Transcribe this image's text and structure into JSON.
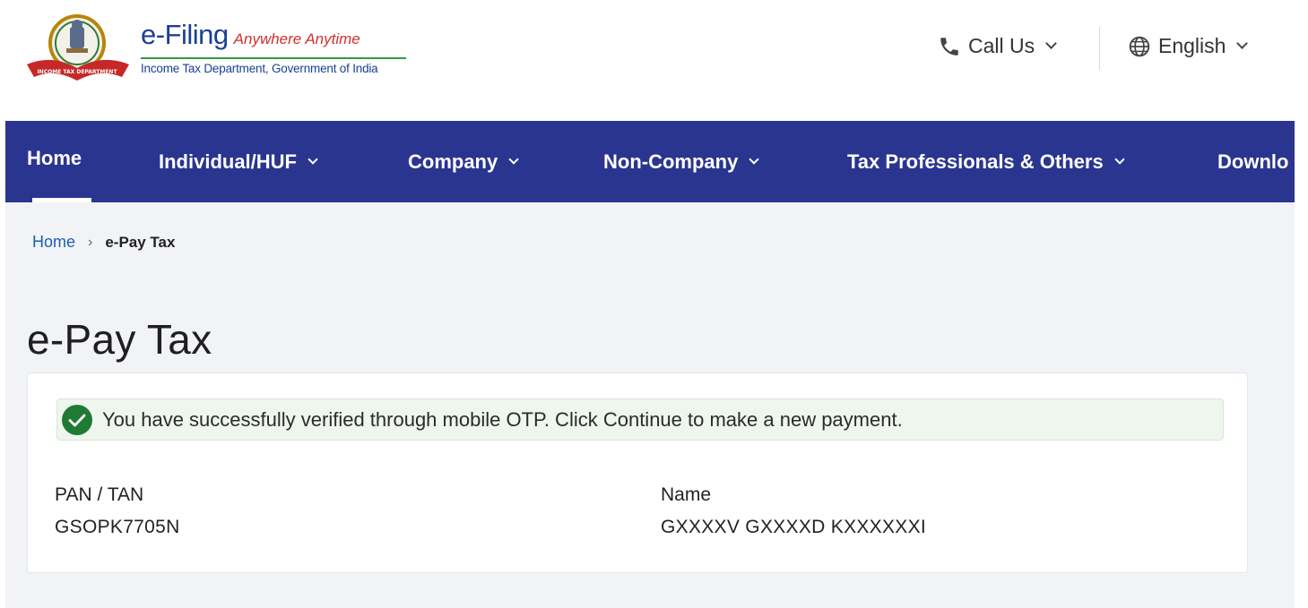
{
  "header": {
    "logo": {
      "title": "e-Filing",
      "tagline": "Anywhere Anytime",
      "subtitle": "Income Tax Department, Government of India",
      "emblem_ribbon_text": "INCOME TAX DEPARTMENT",
      "icon": "emblem-icon"
    },
    "call_us": {
      "label": "Call Us",
      "icon": "phone-icon"
    },
    "language": {
      "label": "English",
      "icon": "globe-icon"
    }
  },
  "nav": {
    "items": [
      {
        "label": "Home",
        "active": true
      },
      {
        "label": "Individual/HUF",
        "has_dropdown": true
      },
      {
        "label": "Company",
        "has_dropdown": true
      },
      {
        "label": "Non-Company",
        "has_dropdown": true
      },
      {
        "label": "Tax Professionals & Others",
        "has_dropdown": true
      },
      {
        "label": "Downlo"
      }
    ]
  },
  "breadcrumb": {
    "home": "Home",
    "separator": "›",
    "current": "e-Pay Tax"
  },
  "page": {
    "title": "e-Pay Tax"
  },
  "alert": {
    "message": "You have successfully verified through mobile OTP. Click Continue to make a new payment.",
    "icon": "check-circle-icon",
    "color": "#1f7a35"
  },
  "details": {
    "pan_label": "PAN / TAN",
    "pan_value": "GSOPK7705N",
    "name_label": "Name",
    "name_value": "GXXXXV GXXXXD KXXXXXXI"
  },
  "colors": {
    "nav_bg": "#2a3590",
    "link": "#1a5fb4",
    "content_bg": "#f2f3f6",
    "success": "#1f7a35"
  }
}
